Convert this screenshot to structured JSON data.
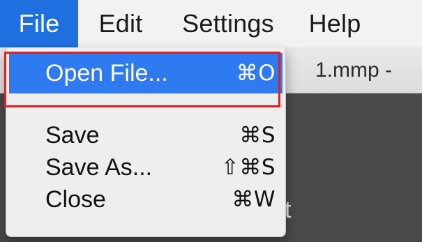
{
  "menubar": {
    "items": [
      {
        "label": "File",
        "active": true
      },
      {
        "label": "Edit",
        "active": false
      },
      {
        "label": "Settings",
        "active": false
      },
      {
        "label": "Help",
        "active": false
      }
    ]
  },
  "background_window": {
    "title_fragment": "1.mmp -",
    "content_fragment": "t"
  },
  "file_menu": {
    "items": [
      {
        "label": "Open File...",
        "shortcut": "⌘O",
        "highlighted": true
      },
      {
        "label": "Save",
        "shortcut": "⌘S",
        "highlighted": false
      },
      {
        "label": "Save As...",
        "shortcut": "⇧⌘S",
        "highlighted": false
      },
      {
        "label": "Close",
        "shortcut": "⌘W",
        "highlighted": false
      }
    ]
  },
  "colors": {
    "menubar_active": "#1f6fe0",
    "menu_highlight": "#2f7af0",
    "annotation_outline": "#e02020"
  }
}
